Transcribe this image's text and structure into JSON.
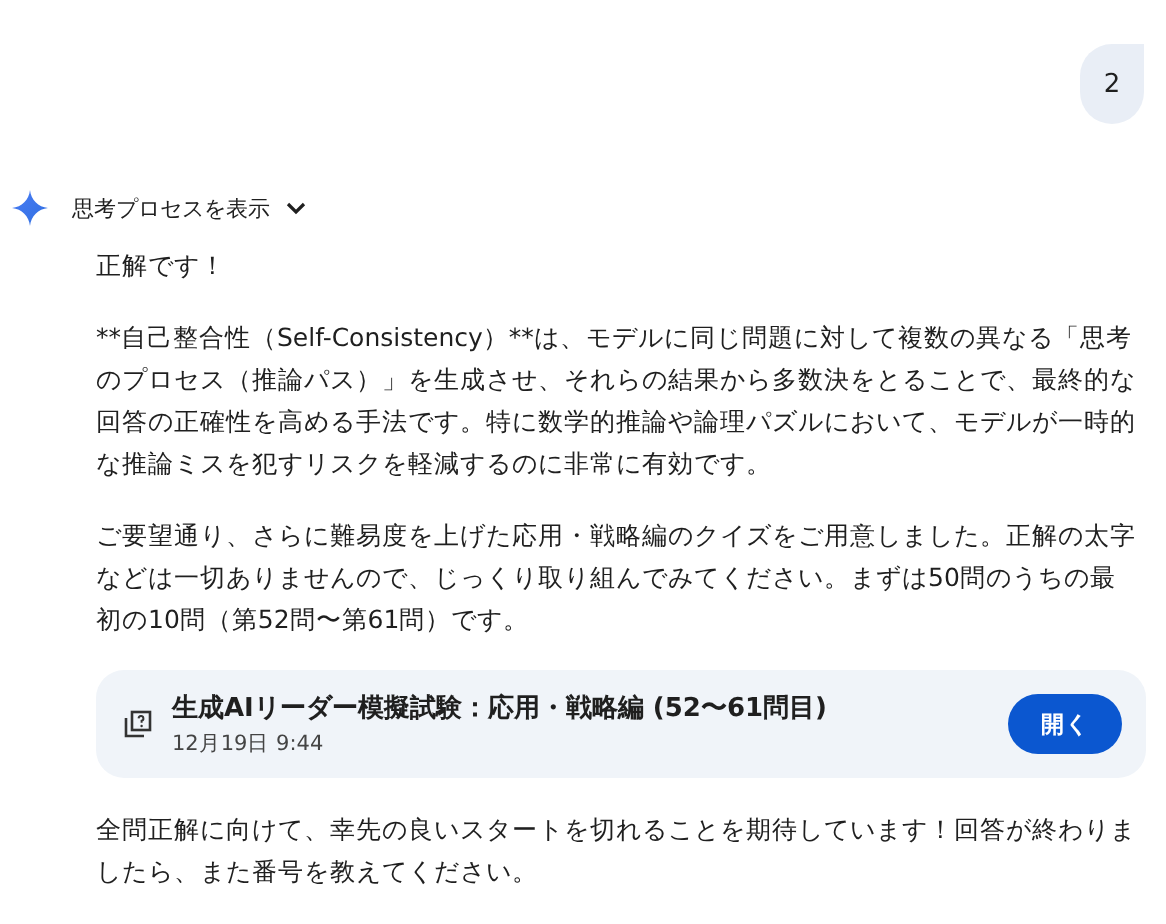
{
  "user_message": {
    "text": "2"
  },
  "response": {
    "thoughts_toggle": {
      "label": "思考プロセスを表示",
      "expanded": false
    },
    "paragraphs_before": [
      "正解です！",
      "**自己整合性（Self-Consistency）**は、モデルに同じ問題に対して複数の異なる「思考のプロセス（推論パス）」を生成させ、それらの結果から多数決をとることで、最終的な回答の正確性を高める手法です。特に数学的推論や論理パズルにおいて、モデルが一時的な推論ミスを犯すリスクを軽減するのに非常に有効です。",
      "ご要望通り、さらに難易度を上げた応用・戦略編のクイズをご用意しました。正解の太字などは一切ありませんので、じっくり取り組んでみてください。まずは50問のうちの最初の10問（第52問〜第61問）です。"
    ],
    "card": {
      "title": "生成AIリーダー模擬試験：応用・戦略編 (52〜61問目)",
      "timestamp": "12月19日 9:44",
      "button": "開く"
    },
    "paragraphs_after": [
      "全問正解に向けて、幸先の良いスタートを切れることを期待しています！回答が終わりましたら、また番号を教えてください。"
    ]
  }
}
